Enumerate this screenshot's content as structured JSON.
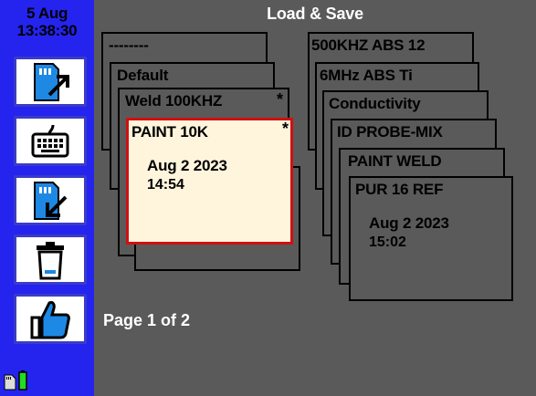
{
  "date": {
    "day": "5 Aug",
    "time": "13:38:30"
  },
  "title": "Load & Save",
  "sidebar": {
    "buttons": [
      {
        "icon": "sd-card-export-icon"
      },
      {
        "icon": "keyboard-icon"
      },
      {
        "icon": "sd-card-import-icon"
      },
      {
        "icon": "trash-icon"
      },
      {
        "icon": "thumbs-up-icon"
      }
    ],
    "status_icons": [
      "sd-card-status-icon",
      "battery-icon"
    ]
  },
  "left_stack": [
    {
      "name": "--------",
      "mark": ""
    },
    {
      "name": "Default",
      "mark": ""
    },
    {
      "name": "Weld 100KHZ",
      "mark": "*"
    },
    {
      "name": "PAINT 10K",
      "mark": "*",
      "date": "Aug 2 2023",
      "time": "14:54",
      "selected": true
    }
  ],
  "right_stack": [
    {
      "name": "500KHZ ABS 12",
      "mark": ""
    },
    {
      "name": "6MHz ABS Ti",
      "mark": ""
    },
    {
      "name": "Conductivity",
      "mark": ""
    },
    {
      "name": "ID PROBE-MIX",
      "mark": ""
    },
    {
      "name": "PAINT WELD",
      "mark": ""
    },
    {
      "name": "PUR 16 REF",
      "mark": "",
      "date": "Aug 2 2023",
      "time": "15:02"
    }
  ],
  "page_indicator": "Page 1 of 2",
  "colors": {
    "sidebar": "#2424ee",
    "background": "#5a5a5a",
    "selected_border": "#d01010",
    "selected_fill": "#fff5dc",
    "battery": "#22dd22"
  }
}
